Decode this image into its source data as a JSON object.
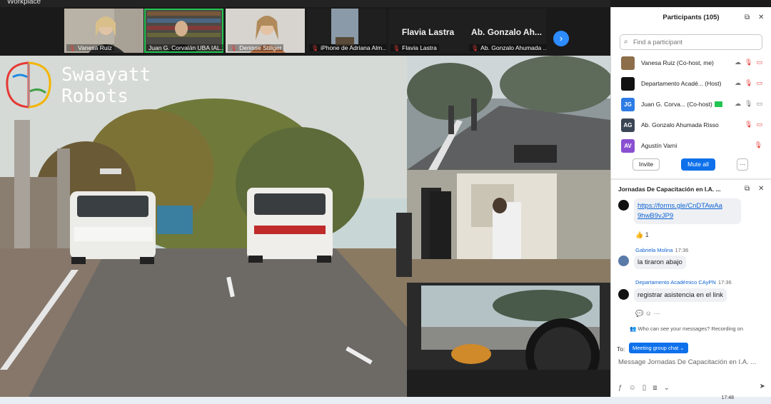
{
  "app": {
    "label": "Workplace"
  },
  "gallery": {
    "tiles": [
      {
        "name": "Vanesa Ruiz",
        "muted": true,
        "active": false
      },
      {
        "name": "Juan G. Corvalán UBA IAL...",
        "muted": false,
        "active": true
      },
      {
        "name": "Denisse Stillger",
        "muted": true,
        "active": false
      },
      {
        "name": "iPhone de Adriana Alm...",
        "muted": true,
        "active": false
      },
      {
        "name": "Flavia Lastra",
        "display": "Flavia Lastra",
        "muted": true,
        "active": false
      },
      {
        "name": "Ab. Gonzalo Ahumada ...",
        "display": "Ab. Gonzalo Ah...",
        "muted": true,
        "active": false
      }
    ],
    "next_icon": "chevron-right-icon"
  },
  "scene": {
    "logo_line1": "Swaayatt",
    "logo_line2": "Robots"
  },
  "participants": {
    "title": "Participants (105)",
    "search_placeholder": "Find a participant",
    "list": [
      {
        "initials": "",
        "name": "Vanesa Ruiz (Co-host, me)",
        "avatar_color": "#8d6e4a"
      },
      {
        "initials": "",
        "name": "Departamento Acadé... (Host)",
        "avatar_color": "#111111"
      },
      {
        "initials": "JG",
        "name": "Juan G. Corva... (Co-host)",
        "avatar_color": "#2d7be5"
      },
      {
        "initials": "AG",
        "name": "Ab. Gonzalo Ahumada Risso",
        "avatar_color": "#3b4654"
      },
      {
        "initials": "AV",
        "name": "Agustín Varni",
        "avatar_color": "#8a4fd0"
      }
    ],
    "invite_label": "Invite",
    "mute_all_label": "Mute all",
    "more_label": "···"
  },
  "chat": {
    "title": "Jornadas De Capacitación en I.A. ...",
    "link_line1": "https://forms.gle/CnDTAwAa",
    "link_line2": "9hwB9vJP9",
    "reaction": "👍 1",
    "msg1_sender": "Gabriela Molina",
    "msg1_time": "17:36",
    "msg1_text": "la tiraron abajo",
    "msg2_sender": "Departamento Académico CAyPN",
    "msg2_time": "17:36",
    "msg2_text": "registrar asistencia en el link",
    "who_can_see": "Who can see your messages? Recording on",
    "to_label": "To:",
    "to_target": "Meeting group chat ⌄",
    "placeholder": "Message Jornadas De Capacitación en I.A. ..."
  },
  "taskbar": {
    "time": "17:48"
  }
}
